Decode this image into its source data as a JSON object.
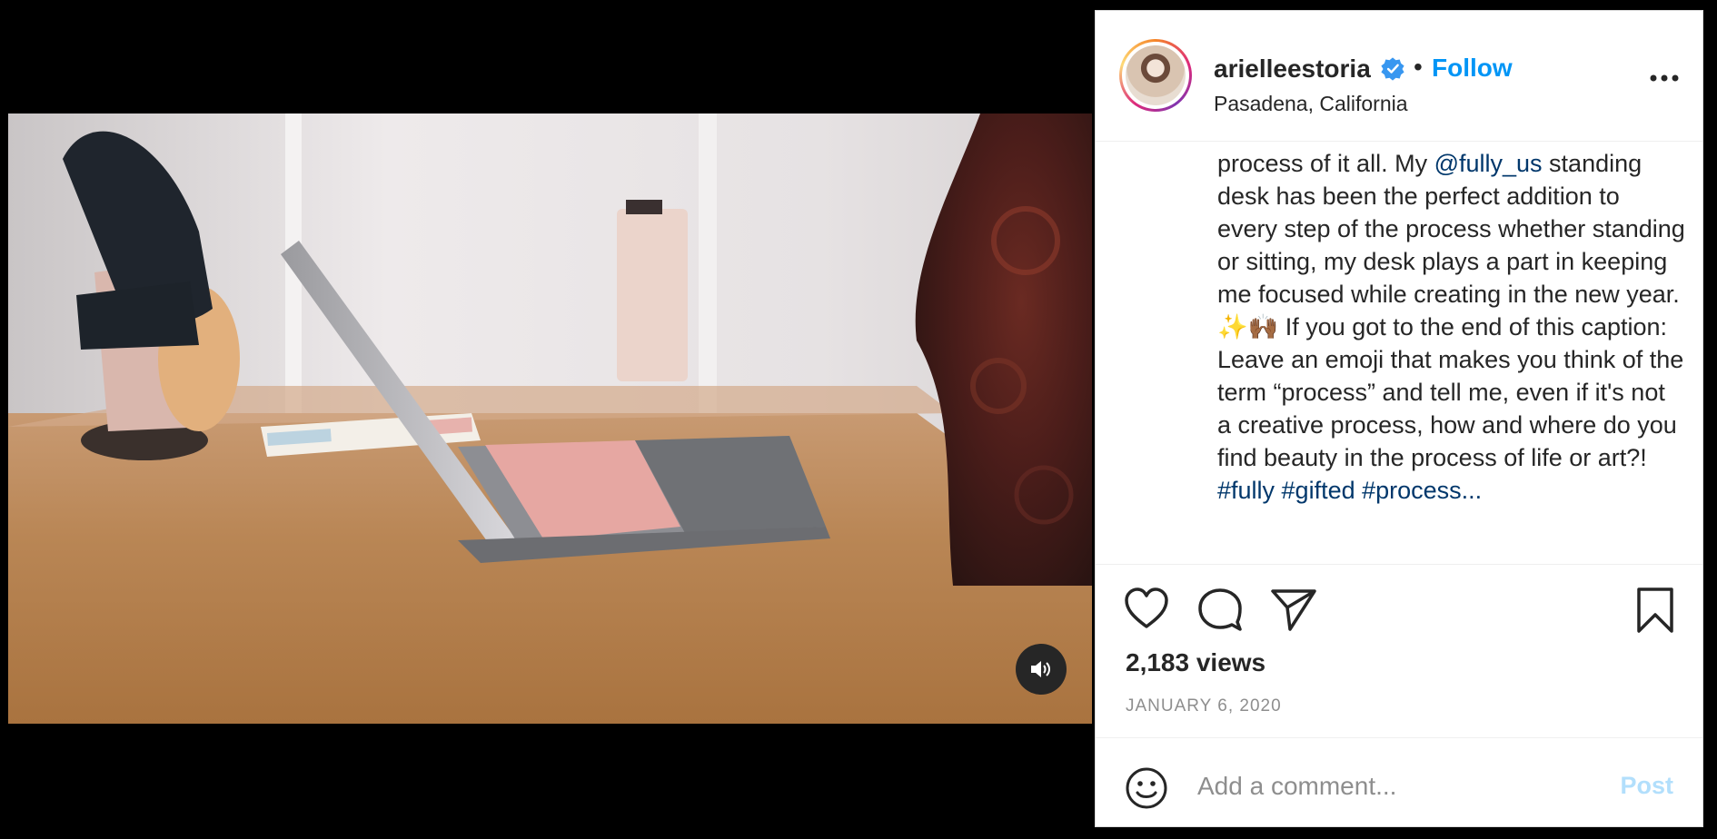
{
  "post": {
    "username": "arielleestoria",
    "separator": "•",
    "follow_label": "Follow",
    "location": "Pasadena, California",
    "caption_lines": [
      "process of it all. My ",
      "@fully_us",
      " standing desk has been the perfect addition to every step of the process whether standing or sitting, my desk plays a part in keeping me focused while creating in the new year. ✨🙌🏾 If you got to the end of this caption:",
      "Leave an emoji that makes you think of the term “process” and tell me, even if it's not a creative process, how and where do you find beauty in the process of life or art?!",
      "#fully #gifted #process..."
    ],
    "views": "2,183 views",
    "date": "JANUARY 6, 2020"
  },
  "comment": {
    "placeholder": "Add a comment...",
    "post_label": "Post"
  },
  "icons": {
    "verified": "verified-badge-icon",
    "more": "more-options-icon",
    "like": "heart-icon",
    "comment": "comment-icon",
    "share": "paper-plane-icon",
    "save": "bookmark-icon",
    "emoji": "smiley-icon",
    "mute": "speaker-icon"
  },
  "colors": {
    "accent": "#0095f6",
    "mention": "#00376b",
    "post_disabled": "#b2dffc"
  }
}
